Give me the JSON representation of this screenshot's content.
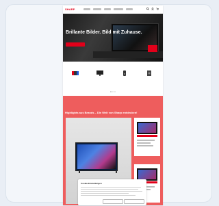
{
  "header": {
    "logo": "SHARP",
    "nav_items": [
      "",
      "",
      "",
      "",
      ""
    ],
    "icons": [
      "search-icon",
      "user-icon",
      "cart-icon"
    ]
  },
  "hero": {
    "title": "Brillante Bilder. Bild mit Zuhause.",
    "cta": ""
  },
  "categories": [
    {
      "name": "",
      "icon": "gaming-console-icon"
    },
    {
      "name": "",
      "icon": "tv-icon"
    },
    {
      "name": "",
      "icon": "speaker-icon"
    },
    {
      "name": "",
      "icon": "appliance-icon"
    }
  ],
  "promo": {
    "title": "Highlights aus Brands – Die Welt von Sharp entdecken!"
  },
  "cookie_banner": {
    "title": "Cookie-Einstellungen",
    "btn_settings": "",
    "btn_accept": ""
  },
  "colors": {
    "brand_red": "#e2001a",
    "promo_bg": "#ee5d5d"
  }
}
